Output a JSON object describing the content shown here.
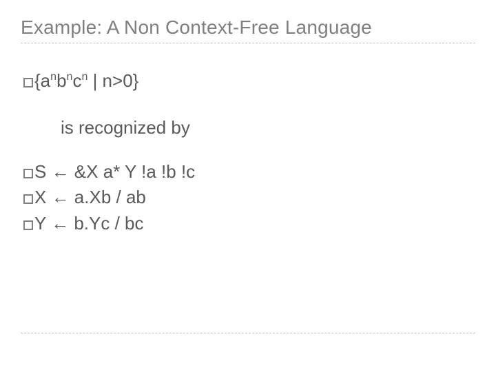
{
  "title": "Example: A Non Context-Free Language",
  "language": {
    "prefix": "{a",
    "sup1": "n",
    "mid1": "b",
    "sup2": "n",
    "mid2": "c",
    "sup3": "n",
    "suffix": " |  n>0}"
  },
  "recognized_by": "is recognized by",
  "rules": {
    "r1_lhs": "S",
    "r1_rhs": " ← &X a* Y !a !b !c",
    "r2_lhs": "X",
    "r2_rhs": " ← a.Xb / ab",
    "r3_lhs": "Y",
    "r3_rhs": " ← b.Yc / bc"
  }
}
